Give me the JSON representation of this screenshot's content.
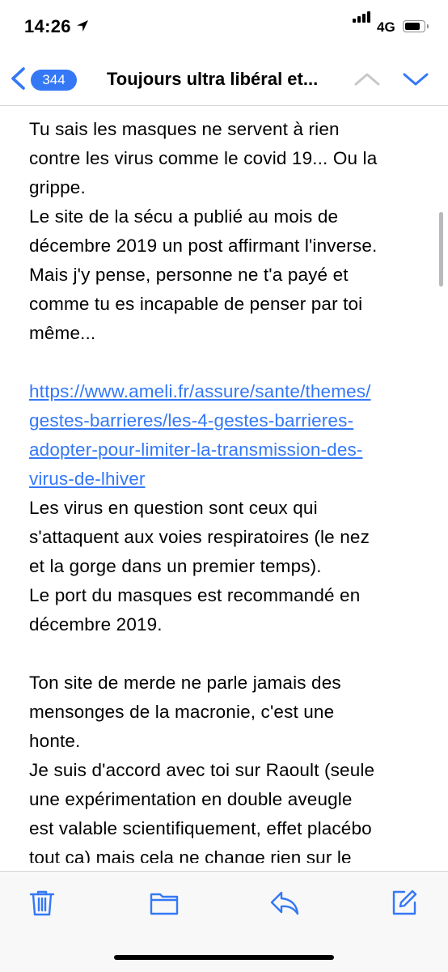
{
  "status_bar": {
    "time": "14:26",
    "network": "4G",
    "icons": [
      "location-arrow-icon",
      "signal-icon",
      "battery-icon"
    ]
  },
  "nav": {
    "unread_count": "344",
    "title": "Toujours ultra libéral et...",
    "icons": [
      "chevron-left-icon",
      "chevron-up-icon",
      "chevron-down-icon"
    ]
  },
  "colors": {
    "accent": "#3478f6",
    "text": "#000000",
    "toolbar_bg": "#f8f8f8",
    "disabled": "#c7c7cc"
  },
  "message": {
    "lines": [
      "Tu sais les masques ne servent à rien",
      "contre les virus comme le covid 19... Ou la",
      "grippe.",
      "Le site de la sécu a publié au mois de",
      "décembre 2019 un post affirmant l'inverse.",
      "Mais j'y pense, personne ne t'a payé et",
      "comme tu es incapable de penser par toi",
      "même...",
      "",
      "https://www.ameli.fr/assure/sante/themes/",
      "gestes-barrieres/les-4-gestes-barrieres-",
      "adopter-pour-limiter-la-transmission-des-",
      "virus-de-lhiver",
      "Les virus en question sont ceux qui",
      "s'attaquent aux voies respiratoires (le nez",
      "et la gorge dans un premier temps).",
      "Le port du masques est recommandé en",
      "décembre 2019.",
      "",
      "Ton site de merde ne parle jamais des",
      "mensonges de la macronie, c'est une",
      "honte.",
      "Je suis d'accord avec toi sur Raoult (seule",
      "une expérimentation en double aveugle",
      "est valable scientifiquement, effet placébo",
      "tout ça) mais cela ne change rien sur le"
    ],
    "link_line_indices": [
      9,
      10,
      11,
      12
    ]
  },
  "toolbar": {
    "icons": [
      "trash-icon",
      "folder-icon",
      "reply-icon",
      "compose-icon"
    ]
  }
}
